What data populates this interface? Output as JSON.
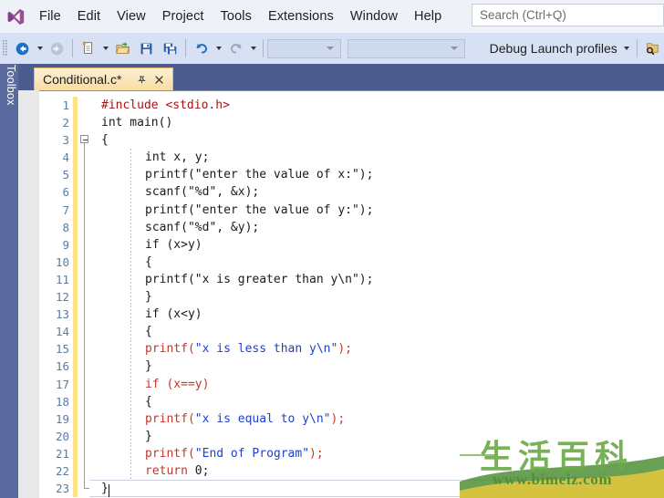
{
  "app": {
    "name": "Microsoft Visual Studio",
    "logo_icon": "visual-studio-logo"
  },
  "menu": {
    "items": [
      {
        "label": "File"
      },
      {
        "label": "Edit"
      },
      {
        "label": "View"
      },
      {
        "label": "Project"
      },
      {
        "label": "Tools"
      },
      {
        "label": "Extensions"
      },
      {
        "label": "Window"
      },
      {
        "label": "Help"
      }
    ]
  },
  "search": {
    "placeholder": "Search (Ctrl+Q)",
    "value": "",
    "icon": "search-icon"
  },
  "toolbar": {
    "grip_icon": "drag-grip-icon",
    "nav_back_icon": "navigate-back-icon",
    "nav_forward_icon": "navigate-forward-icon",
    "new_item_icon": "new-item-icon",
    "open_file_icon": "open-file-icon",
    "save_icon": "save-icon",
    "save_all_icon": "save-all-icon",
    "undo_icon": "undo-icon",
    "redo_icon": "redo-icon",
    "config_dropdown_value": "",
    "platform_dropdown_value": "",
    "debug_target_label": "Debug Launch profiles",
    "find_in_files_icon": "find-in-folder-icon"
  },
  "toolbox": {
    "label": "Toolbox"
  },
  "tab": {
    "label": "Conditional.c*",
    "pin_icon": "pin-icon",
    "close_icon": "close-icon"
  },
  "editor": {
    "language": "c",
    "cursor_line": 23,
    "lines": [
      {
        "n": "1",
        "indent": 0,
        "fold": "start",
        "tokens": [
          {
            "t": "#include ",
            "c": "pre"
          },
          {
            "t": "<stdio.h>",
            "c": "inc"
          }
        ]
      },
      {
        "n": "2",
        "indent": 0,
        "fold": "none",
        "tokens": [
          {
            "t": "int main()",
            "c": "plain"
          }
        ]
      },
      {
        "n": "3",
        "indent": 0,
        "fold": "box",
        "tokens": [
          {
            "t": "{",
            "c": "plain"
          }
        ]
      },
      {
        "n": "4",
        "indent": 1,
        "fold": "line",
        "tokens": [
          {
            "t": "int x, y;",
            "c": "plain"
          }
        ]
      },
      {
        "n": "5",
        "indent": 1,
        "fold": "line",
        "tokens": [
          {
            "t": "printf(\"enter the value of x:\");",
            "c": "plain"
          }
        ]
      },
      {
        "n": "6",
        "indent": 1,
        "fold": "line",
        "tokens": [
          {
            "t": "scanf(\"%d\", &x);",
            "c": "plain"
          }
        ]
      },
      {
        "n": "7",
        "indent": 1,
        "fold": "line",
        "tokens": [
          {
            "t": "printf(\"enter the value of y:\");",
            "c": "plain"
          }
        ]
      },
      {
        "n": "8",
        "indent": 1,
        "fold": "line",
        "tokens": [
          {
            "t": "scanf(\"%d\", &y);",
            "c": "plain"
          }
        ]
      },
      {
        "n": "9",
        "indent": 1,
        "fold": "line",
        "tokens": [
          {
            "t": "if (x>y)",
            "c": "plain"
          }
        ]
      },
      {
        "n": "10",
        "indent": 1,
        "fold": "line",
        "tokens": [
          {
            "t": "{",
            "c": "plain"
          }
        ]
      },
      {
        "n": "11",
        "indent": 1,
        "fold": "line",
        "tokens": [
          {
            "t": "printf(\"x is greater than y\\n\");",
            "c": "plain"
          }
        ]
      },
      {
        "n": "12",
        "indent": 1,
        "fold": "line",
        "tokens": [
          {
            "t": "}",
            "c": "plain"
          }
        ]
      },
      {
        "n": "13",
        "indent": 1,
        "fold": "line",
        "tokens": [
          {
            "t": "if (x<y)",
            "c": "plain"
          }
        ]
      },
      {
        "n": "14",
        "indent": 1,
        "fold": "line",
        "tokens": [
          {
            "t": "{",
            "c": "plain"
          }
        ]
      },
      {
        "n": "15",
        "indent": 1,
        "fold": "line",
        "tokens": [
          {
            "t": "printf(",
            "c": "fn"
          },
          {
            "t": "\"x is less than y\\n\"",
            "c": "str"
          },
          {
            "t": ");",
            "c": "fn"
          }
        ]
      },
      {
        "n": "16",
        "indent": 1,
        "fold": "line",
        "tokens": [
          {
            "t": "}",
            "c": "plain"
          }
        ]
      },
      {
        "n": "17",
        "indent": 1,
        "fold": "line",
        "tokens": [
          {
            "t": "if (x==y)",
            "c": "fn"
          }
        ]
      },
      {
        "n": "18",
        "indent": 1,
        "fold": "line",
        "tokens": [
          {
            "t": "{",
            "c": "plain"
          }
        ]
      },
      {
        "n": "19",
        "indent": 1,
        "fold": "line",
        "tokens": [
          {
            "t": "printf(",
            "c": "fn"
          },
          {
            "t": "\"x is equal to y\\n\"",
            "c": "str"
          },
          {
            "t": ");",
            "c": "fn"
          }
        ]
      },
      {
        "n": "20",
        "indent": 1,
        "fold": "line",
        "tokens": [
          {
            "t": "}",
            "c": "plain"
          }
        ]
      },
      {
        "n": "21",
        "indent": 1,
        "fold": "line",
        "tokens": [
          {
            "t": "printf(",
            "c": "fn"
          },
          {
            "t": "\"End of Program\"",
            "c": "str"
          },
          {
            "t": ");",
            "c": "fn"
          }
        ]
      },
      {
        "n": "22",
        "indent": 1,
        "fold": "line",
        "tokens": [
          {
            "t": "return ",
            "c": "kw"
          },
          {
            "t": "0;",
            "c": "plain"
          }
        ]
      },
      {
        "n": "23",
        "indent": 0,
        "fold": "end",
        "tokens": [
          {
            "t": "}",
            "c": "plain"
          }
        ]
      }
    ]
  },
  "watermark": {
    "chinese": "生活百科",
    "url": "www.bimeiz.com"
  },
  "colors": {
    "menubar_bg": "#eef1f8",
    "toolbar_bg": "#d7e1f3",
    "tabstrip_bg": "#4c5c8e",
    "toolbox_bg": "#5b6a9e",
    "tab_active_bg": "#f7dca4",
    "editor_bg": "#ffffff",
    "line_number": "#5a7ca5",
    "change_marker": "#fbe38a",
    "string_literal": "#1f3fcc",
    "function_name": "#c0392b",
    "preprocessor": "#a31515",
    "watermark_green": "#6cab4a"
  }
}
